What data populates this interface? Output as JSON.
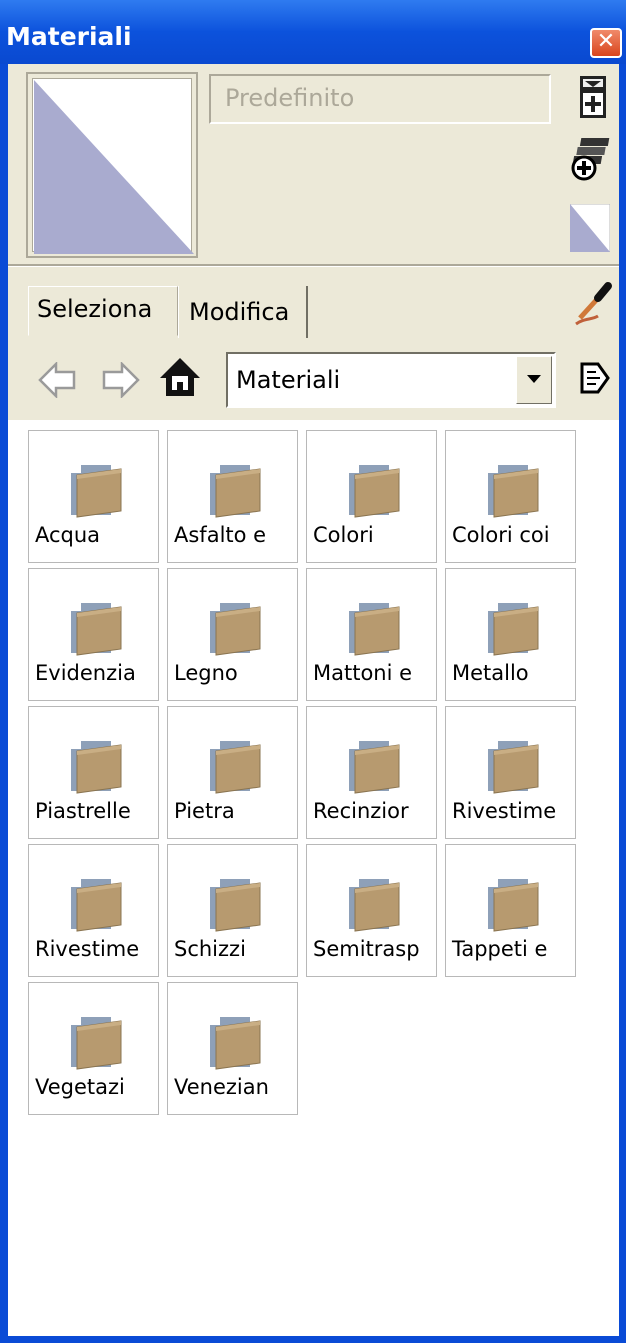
{
  "window": {
    "title": "Materiali",
    "close_glyph": "✕"
  },
  "name_field": {
    "placeholder": "Predefinito"
  },
  "tabs": [
    {
      "label": "Seleziona"
    },
    {
      "label": "Modifica"
    }
  ],
  "nav": {
    "library": "Materiali"
  },
  "folders": [
    {
      "label": "Acqua"
    },
    {
      "label": "Asfalto e"
    },
    {
      "label": "Colori"
    },
    {
      "label": "Colori coi"
    },
    {
      "label": "Evidenzia"
    },
    {
      "label": "Legno"
    },
    {
      "label": "Mattoni e"
    },
    {
      "label": "Metallo"
    },
    {
      "label": "Piastrelle"
    },
    {
      "label": "Pietra"
    },
    {
      "label": "Recinzior"
    },
    {
      "label": "Rivestime"
    },
    {
      "label": "Rivestime"
    },
    {
      "label": "Schizzi"
    },
    {
      "label": "Semitrasp"
    },
    {
      "label": "Tappeti e"
    },
    {
      "label": "Vegetazi"
    },
    {
      "label": "Venezian"
    }
  ],
  "colors": {
    "title_bar": "#0a4bd6",
    "panel": "#ece9d8",
    "default_material": "#a9abcf",
    "folder": "#b79a6f"
  },
  "icons": [
    "create-material-icon",
    "sample-paint-icon",
    "default-material-icon",
    "eyedropper-icon",
    "back-arrow-icon",
    "forward-arrow-icon",
    "home-icon",
    "dropdown-arrow-icon",
    "details-arrow-icon",
    "folder-icon"
  ]
}
